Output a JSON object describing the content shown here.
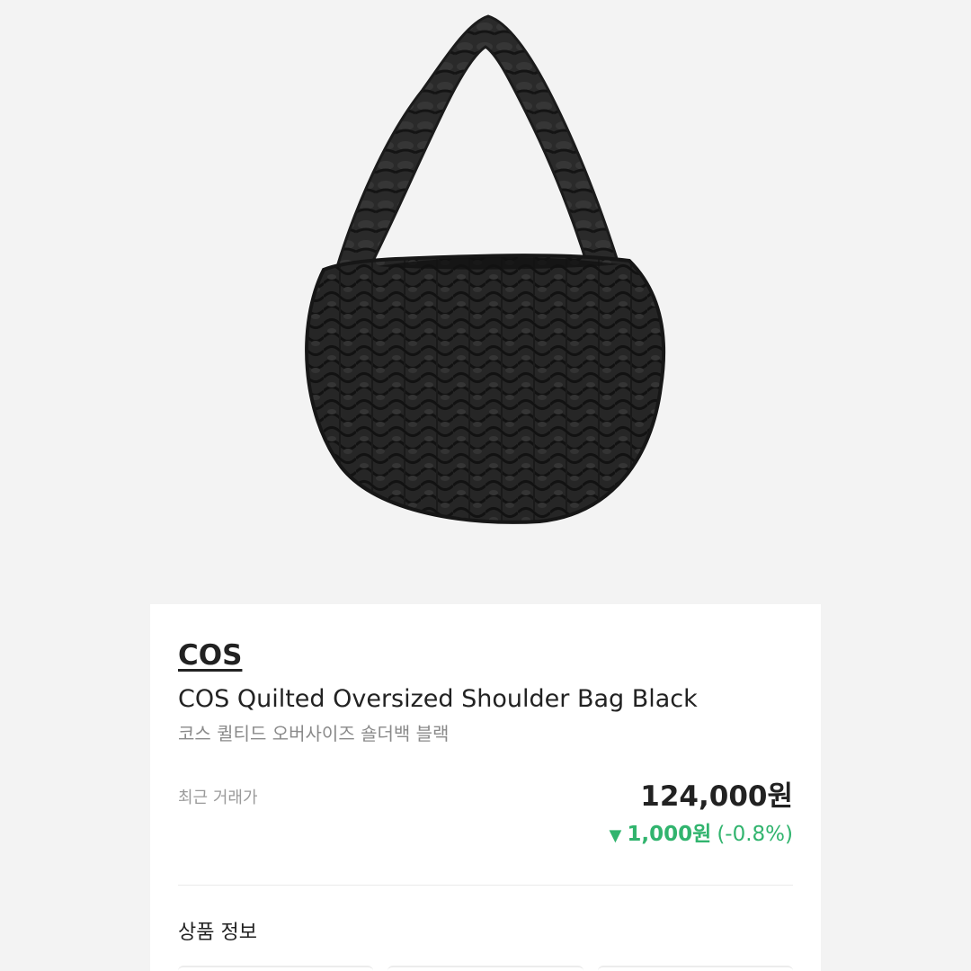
{
  "product": {
    "brand": "COS",
    "name_en": "COS Quilted Oversized Shoulder Bag Black",
    "name_ko": "코스 퀼티드 오버사이즈 숄더백 블랙"
  },
  "price_info": {
    "label": "최근 거래가",
    "price": "124,000원",
    "change_icon": "down-triangle-icon",
    "change_symbol": "▼",
    "change_amount": "1,000원",
    "change_percent": "(-0.8%)",
    "change_color": "#31b46e"
  },
  "sections": {
    "product_info_title": "상품 정보"
  },
  "colors": {
    "background": "#f3f3f3",
    "card": "#ffffff",
    "text_primary": "#222222",
    "text_secondary": "#8a8a8a",
    "down": "#31b46e"
  }
}
